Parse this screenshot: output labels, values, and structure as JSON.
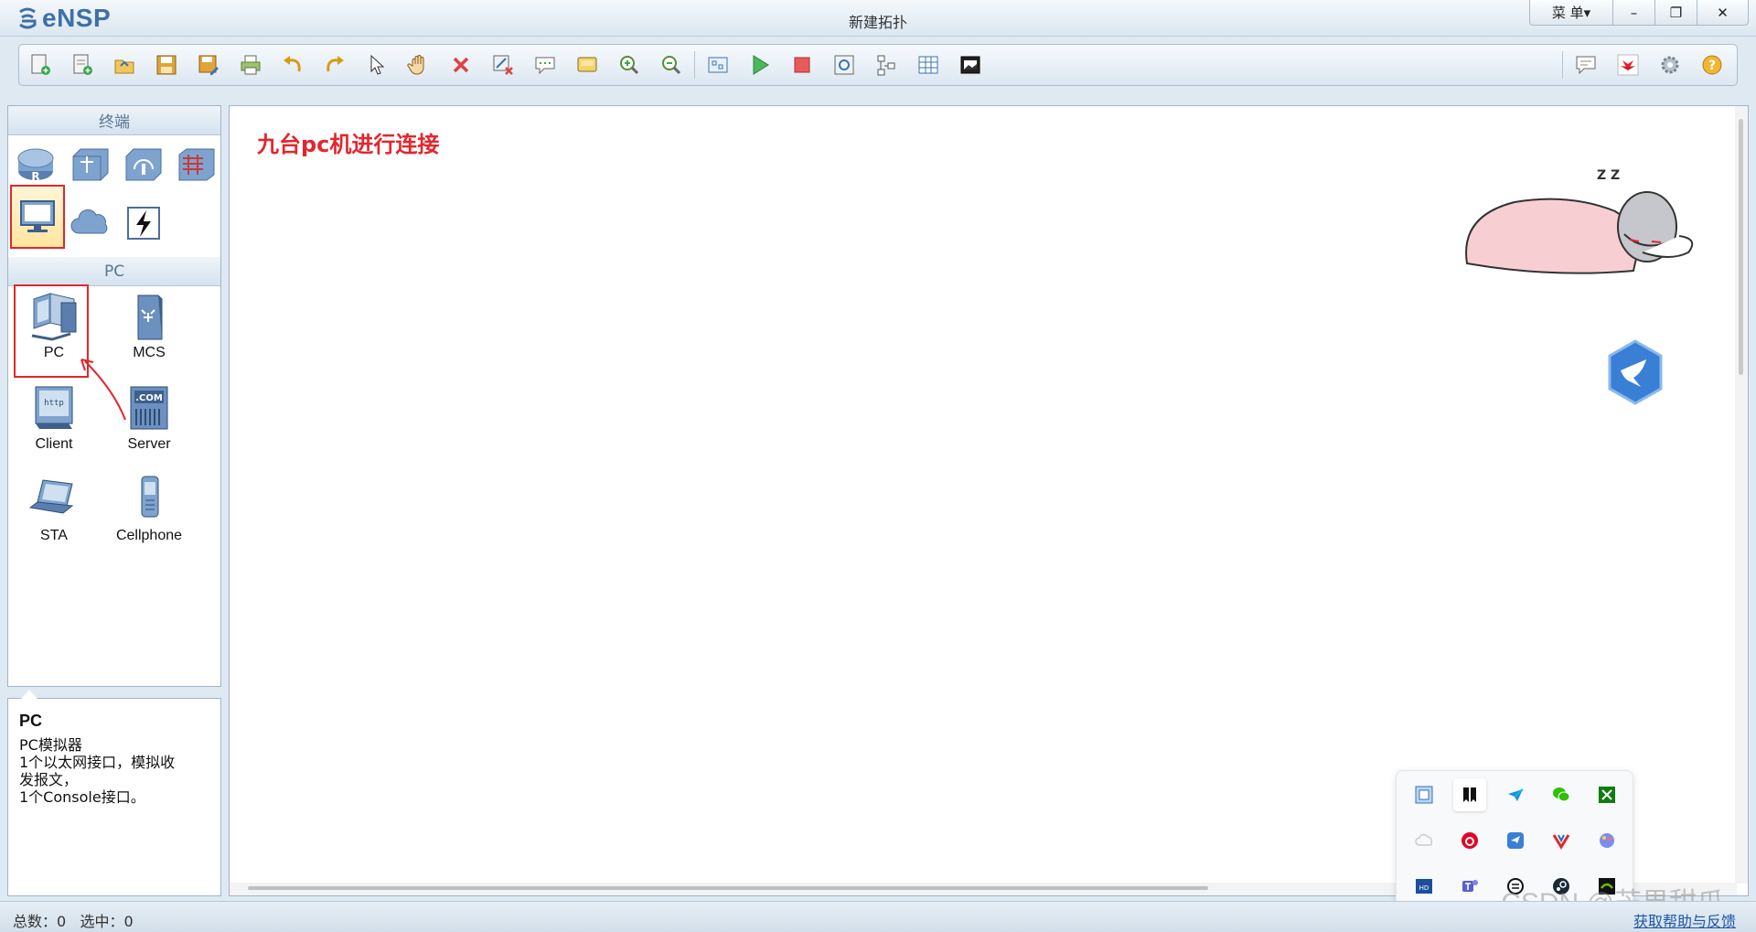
{
  "app": {
    "logo_text": "eNSP",
    "window_title": "新建拓扑"
  },
  "window_controls": {
    "menu_label": "菜 单▾",
    "minimize": "–",
    "restore": "❐",
    "close": "✕"
  },
  "toolbar": {
    "left_icons": [
      "new-topology-icon",
      "new-example-icon",
      "open-icon",
      "save-icon",
      "save-as-icon",
      "print-icon",
      "undo-icon",
      "redo-icon",
      "select-icon",
      "pan-hand-icon",
      "delete-icon",
      "delete-link-icon",
      "add-text-icon",
      "palette-icon",
      "zoom-in-icon",
      "zoom-out-icon",
      "fit-icon",
      "start-device-icon",
      "stop-device-icon",
      "capture-icon",
      "topology-icon",
      "grid-icon",
      "screenshot-icon"
    ],
    "right_icons": [
      "chat-icon",
      "huawei-icon",
      "settings-icon",
      "help-icon"
    ]
  },
  "left_panel": {
    "category_header": "终端",
    "category_icons": [
      "router-icon",
      "switch-icon",
      "wlan-icon",
      "firewall-icon",
      "terminal-icon",
      "cloud-icon",
      "connection-icon"
    ],
    "device_header": "PC",
    "devices": [
      {
        "label": "PC",
        "icon": "pc-icon"
      },
      {
        "label": "MCS",
        "icon": "mcs-icon"
      },
      {
        "label": "Client",
        "icon": "client-icon"
      },
      {
        "label": "Server",
        "icon": "server-icon"
      },
      {
        "label": "STA",
        "icon": "sta-icon"
      },
      {
        "label": "Cellphone",
        "icon": "cellphone-icon"
      }
    ],
    "description": {
      "title": "PC",
      "line1": "PC模拟器",
      "line2": "1个以太网接口，模拟收",
      "line3": "发报文，",
      "line4": "1个Console接口。"
    }
  },
  "canvas": {
    "annotation": "九台pc机进行连接",
    "sleep_text": "Z Z"
  },
  "tray": {
    "icons": [
      "app-grid-icon",
      "bookmark-app-icon",
      "feishu-icon",
      "wechat-icon",
      "xbox-icon",
      "cloud-tray-icon",
      "netease-music-icon",
      "bird-app-icon",
      "vpn-icon",
      "paint-icon",
      "hdmi-app-icon",
      "teams-icon",
      "chatgpt-icon",
      "steam-icon",
      "nvidia-icon"
    ]
  },
  "status": {
    "total_label": "总数：",
    "total_value": "0",
    "selected_label": "选中：",
    "selected_value": "0",
    "help_link": "获取帮助与反馈"
  },
  "watermark": "CSDN @芒果甜爪"
}
